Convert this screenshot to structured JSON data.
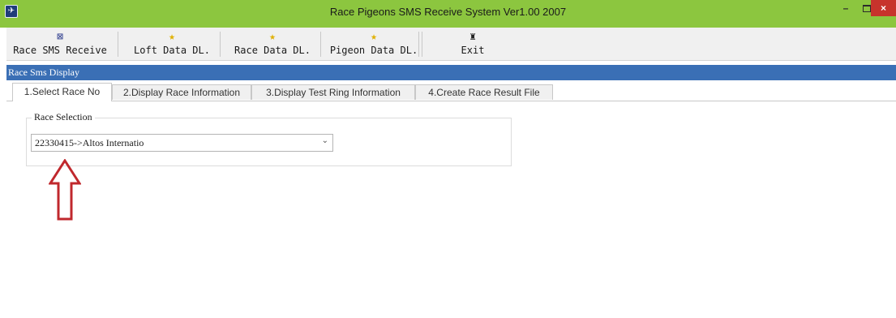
{
  "window": {
    "title": "Race Pigeons SMS Receive System Ver1.00 2007",
    "controls": {
      "minimize": "–",
      "close": "×"
    }
  },
  "toolbar": {
    "buttons": [
      {
        "label": "Race SMS Receive",
        "icon": "sms-receive-icon"
      },
      {
        "label": "Loft Data DL.",
        "icon": "runner-icon"
      },
      {
        "label": "Race Data DL.",
        "icon": "runner-icon"
      },
      {
        "label": "Pigeon Data DL.",
        "icon": "runner-icon"
      },
      {
        "label": "Exit",
        "icon": "exit-door-icon"
      }
    ]
  },
  "section_title": "Race Sms Display",
  "tabs": [
    {
      "label": "1.Select Race No",
      "active": true
    },
    {
      "label": "2.Display Race Information",
      "active": false
    },
    {
      "label": "3.Display Test Ring Information",
      "active": false
    },
    {
      "label": "4.Create Race Result File",
      "active": false
    }
  ],
  "race_selection": {
    "group_label": "Race Selection",
    "selected_value": "22330415->Altos Internatio"
  },
  "colors": {
    "title_bar": "#8cc63f",
    "section_bar": "#3a6fb5",
    "close_button": "#c7332c",
    "annotation_arrow": "#c0282d"
  }
}
